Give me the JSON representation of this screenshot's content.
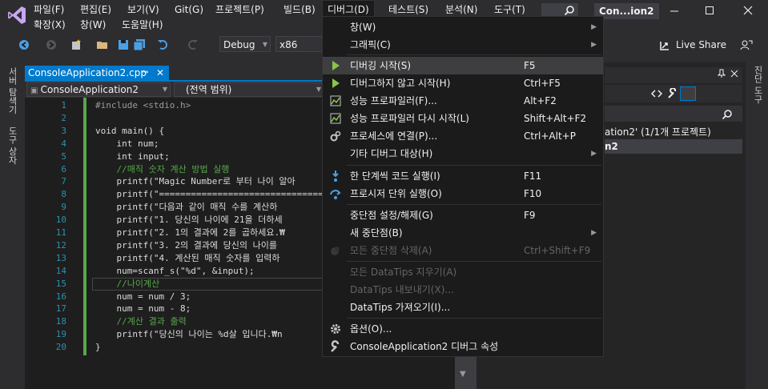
{
  "menubar": {
    "items": [
      "파일(F)",
      "편집(E)",
      "보기(V)",
      "Git(G)",
      "프로젝트(P)",
      "빌드(B)",
      "디버그(D)",
      "테스트(S)",
      "분석(N)",
      "도구(T)"
    ],
    "items_row2": [
      "확장(X)",
      "창(W)",
      "도움말(H)"
    ],
    "window_title": "Con...ion2"
  },
  "toolbar": {
    "config": "Debug",
    "platform": "x86",
    "live_share": "Live Share"
  },
  "left_rail": {
    "tab1": "서버 탐색기",
    "tab2": "도구 상자"
  },
  "right_rail": {
    "tab1": "진단 도구"
  },
  "document": {
    "tab_label": "ConsoleApplication2.cpp",
    "nav_scope": "ConsoleApplication2",
    "nav_member": "(전역 범위)"
  },
  "code_lines": [
    {
      "n": "1",
      "text": "#include <stdio.h>"
    },
    {
      "n": "2",
      "text": ""
    },
    {
      "n": "3",
      "text": "void main() {"
    },
    {
      "n": "4",
      "text": "    int num;"
    },
    {
      "n": "5",
      "text": "    int input;"
    },
    {
      "n": "6",
      "text": "    //매직 숫자 계산 방법 실행"
    },
    {
      "n": "7",
      "text": "    printf(\"Magic Number로 부터 나이 알아"
    },
    {
      "n": "8",
      "text": "    printf(\"================================"
    },
    {
      "n": "9",
      "text": "    printf(\"다음과 같이 매직 수를 계산하"
    },
    {
      "n": "10",
      "text": "    printf(\"1. 당신의 나이에 21을 더하세"
    },
    {
      "n": "11",
      "text": "    printf(\"2. 1의 결과에 2를 곱하세요.₩"
    },
    {
      "n": "12",
      "text": "    printf(\"3. 2의 결과에 당신의 나이를"
    },
    {
      "n": "13",
      "text": "    printf(\"4. 계산된 매직 숫자를 입력하"
    },
    {
      "n": "14",
      "text": "    num=scanf_s(\"%d\", &input);"
    },
    {
      "n": "15",
      "text": "    //나이계산"
    },
    {
      "n": "16",
      "text": "    num = num / 3;"
    },
    {
      "n": "17",
      "text": "    num = num - 8;"
    },
    {
      "n": "18",
      "text": "    //계산 결과 출력"
    },
    {
      "n": "19",
      "text": "    printf(\"당신의 나이는 %d살 입니다.₩n"
    },
    {
      "n": "20",
      "text": "}"
    }
  ],
  "solution": {
    "line1": "ation2' (1/1개 프로젝트)",
    "line2": "n2"
  },
  "debug_menu": {
    "items": [
      {
        "label": "창(W)",
        "shortcut": "",
        "icon": "",
        "submenu": true,
        "disabled": false
      },
      {
        "label": "그래픽(C)",
        "shortcut": "",
        "icon": "",
        "submenu": true,
        "disabled": false
      },
      {
        "label": "디버깅 시작(S)",
        "shortcut": "F5",
        "icon": "play-icon",
        "submenu": false,
        "disabled": false,
        "highlight": true
      },
      {
        "label": "디버그하지 않고 시작(H)",
        "shortcut": "Ctrl+F5",
        "icon": "play-outline-icon",
        "submenu": false,
        "disabled": false
      },
      {
        "label": "성능 프로파일러(F)...",
        "shortcut": "Alt+F2",
        "icon": "profiler-icon",
        "submenu": false,
        "disabled": false
      },
      {
        "label": "성능 프로파일러 다시 시작(L)",
        "shortcut": "Shift+Alt+F2",
        "icon": "profiler-icon",
        "submenu": false,
        "disabled": false
      },
      {
        "label": "프로세스에 연결(P)...",
        "shortcut": "Ctrl+Alt+P",
        "icon": "gears-icon",
        "submenu": false,
        "disabled": false
      },
      {
        "label": "기타 디버그 대상(H)",
        "shortcut": "",
        "icon": "",
        "submenu": true,
        "disabled": false
      },
      {
        "label": "한 단계씩 코드 실행(I)",
        "shortcut": "F11",
        "icon": "step-into-icon",
        "submenu": false,
        "disabled": false
      },
      {
        "label": "프로시저 단위 실행(O)",
        "shortcut": "F10",
        "icon": "step-over-icon",
        "submenu": false,
        "disabled": false
      },
      {
        "label": "중단점 설정/해제(G)",
        "shortcut": "F9",
        "icon": "",
        "submenu": false,
        "disabled": false
      },
      {
        "label": "새 중단점(B)",
        "shortcut": "",
        "icon": "",
        "submenu": true,
        "disabled": false
      },
      {
        "label": "모든 중단점 삭제(A)",
        "shortcut": "Ctrl+Shift+F9",
        "icon": "breakpoints-icon",
        "submenu": false,
        "disabled": true
      },
      {
        "label": "모든 DataTips 지우기(A)",
        "shortcut": "",
        "icon": "",
        "submenu": false,
        "disabled": true
      },
      {
        "label": "DataTips 내보내기(X)...",
        "shortcut": "",
        "icon": "",
        "submenu": false,
        "disabled": true
      },
      {
        "label": "DataTips 가져오기(I)...",
        "shortcut": "",
        "icon": "",
        "submenu": false,
        "disabled": false
      },
      {
        "label": "옵션(O)...",
        "shortcut": "",
        "icon": "gear-icon",
        "submenu": false,
        "disabled": false
      },
      {
        "label": "ConsoleApplication2 디버그 속성",
        "shortcut": "",
        "icon": "wrench-icon",
        "submenu": false,
        "disabled": false
      }
    ]
  },
  "colors": {
    "accent": "#007acc",
    "menu_bg": "#1b1b1c",
    "editor_bg": "#1e1e1e",
    "play_green": "#8bc34a"
  }
}
